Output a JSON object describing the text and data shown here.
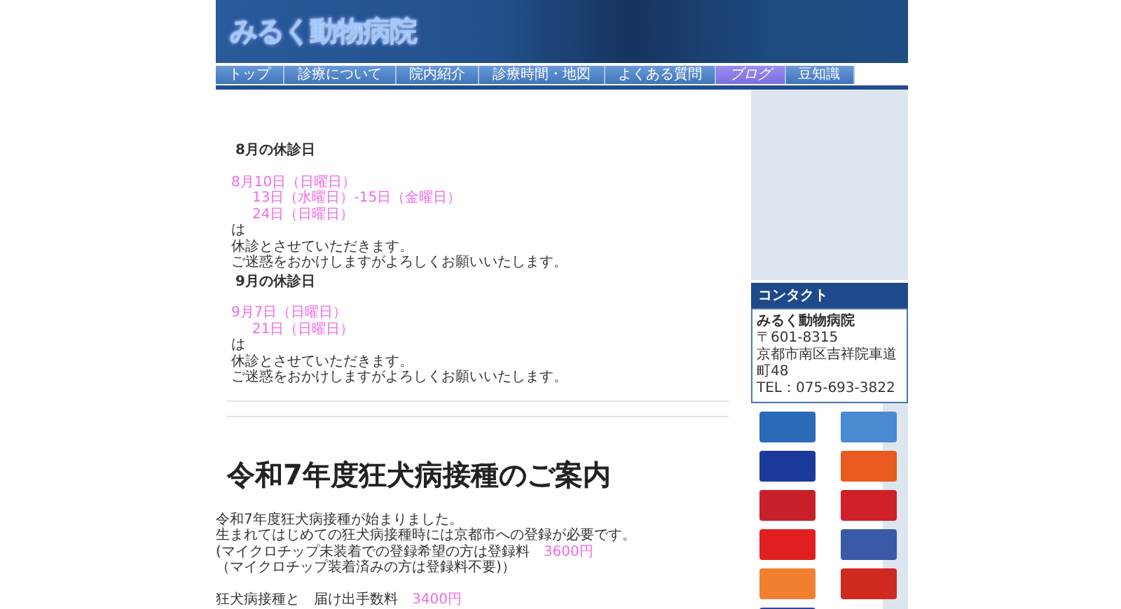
{
  "site": {
    "title": "みるく動物病院"
  },
  "nav": [
    {
      "label": "トップ",
      "selected": false
    },
    {
      "label": "診療について",
      "selected": false
    },
    {
      "label": "院内紹介",
      "selected": false
    },
    {
      "label": "診療時間・地図",
      "selected": false
    },
    {
      "label": "よくある質問",
      "selected": false
    },
    {
      "label": "ブログ",
      "selected": true
    },
    {
      "label": "豆知識",
      "selected": false
    }
  ],
  "notices": [
    {
      "title": "8月の休診日",
      "dates": [
        {
          "text": "8月10日（日曜日）",
          "kind": "first"
        },
        {
          "text": "13日（水曜日）-15日（金曜日）",
          "kind": "continued"
        },
        {
          "text": "24日（日曜日）",
          "kind": "continued"
        }
      ],
      "lines": [
        "は",
        "休診とさせていただきます。",
        "ご迷惑をおかけしますがよろしくお願いいたします。"
      ]
    },
    {
      "title": "9月の休診日",
      "dates": [
        {
          "text": "9月7日（日曜日）",
          "kind": "first"
        },
        {
          "text": "21日（日曜日）",
          "kind": "continued"
        }
      ],
      "lines": [
        "は",
        "休診とさせていただきます。",
        "ご迷惑をおかけしますがよろしくお願いいたします。"
      ]
    }
  ],
  "vaccination": {
    "heading": "令和7年度狂犬病接種のご案内",
    "paragraphs": [
      [
        {
          "text": "令和7年度狂犬病接種が始まりました。"
        },
        {
          "text": "生まれてはじめての狂犬病接種時には京都市への登録が必要です。"
        },
        {
          "text": "(マイクロチップ未装着での登録希望の方は登録料",
          "price": "3600円"
        },
        {
          "text": "（マイクロチップ装着済みの方は登録料不要)）"
        }
      ],
      [
        {
          "text": "狂犬病接種と　届け出手数料",
          "price": "3400円"
        }
      ]
    ]
  },
  "contact": {
    "heading": "コンタクト",
    "name": "みるく動物病院",
    "lines": [
      "〒601-8315",
      "京都市南区吉祥院車道町48",
      "TEL：075-693-3822"
    ]
  }
}
